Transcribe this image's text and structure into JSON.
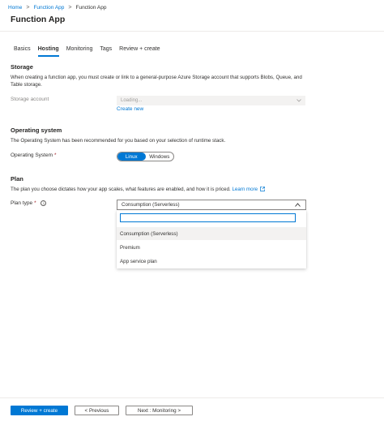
{
  "breadcrumb": {
    "items": [
      {
        "label": "Home"
      },
      {
        "label": "Function App"
      },
      {
        "label": "Function App"
      }
    ],
    "separator": ">"
  },
  "page": {
    "title": "Function App"
  },
  "tabs": [
    {
      "label": "Basics",
      "active": false
    },
    {
      "label": "Hosting",
      "active": true
    },
    {
      "label": "Monitoring",
      "active": false
    },
    {
      "label": "Tags",
      "active": false
    },
    {
      "label": "Review + create",
      "active": false
    }
  ],
  "storage": {
    "heading": "Storage",
    "description": "When creating a function app, you must create or link to a general-purpose Azure Storage account that supports Blobs, Queue, and Table storage.",
    "label": "Storage account",
    "value": "Loading...",
    "create_new": "Create new"
  },
  "os": {
    "heading": "Operating system",
    "description": "The Operating System has been recommended for you based on your selection of runtime stack.",
    "label": "Operating System",
    "required_mark": "*",
    "options": [
      "Linux",
      "Windows"
    ],
    "selected": "Linux"
  },
  "plan": {
    "heading": "Plan",
    "description": "The plan you choose dictates how your app scales, what features are enabled, and how it is priced.",
    "learn_more": "Learn more",
    "label": "Plan type",
    "required_mark": "*",
    "selected": "Consumption (Serverless)",
    "search_value": "",
    "options": [
      {
        "label": "Consumption (Serverless)",
        "selected": true
      },
      {
        "label": "Premium",
        "selected": false
      },
      {
        "label": "App service plan",
        "selected": false
      }
    ]
  },
  "footer": {
    "review_create": "Review + create",
    "previous": "< Previous",
    "next": "Next : Monitoring >"
  },
  "colors": {
    "accent": "#0078d4",
    "text": "#323130",
    "required": "#a4262c",
    "disabled_bg": "#f3f2f1"
  }
}
